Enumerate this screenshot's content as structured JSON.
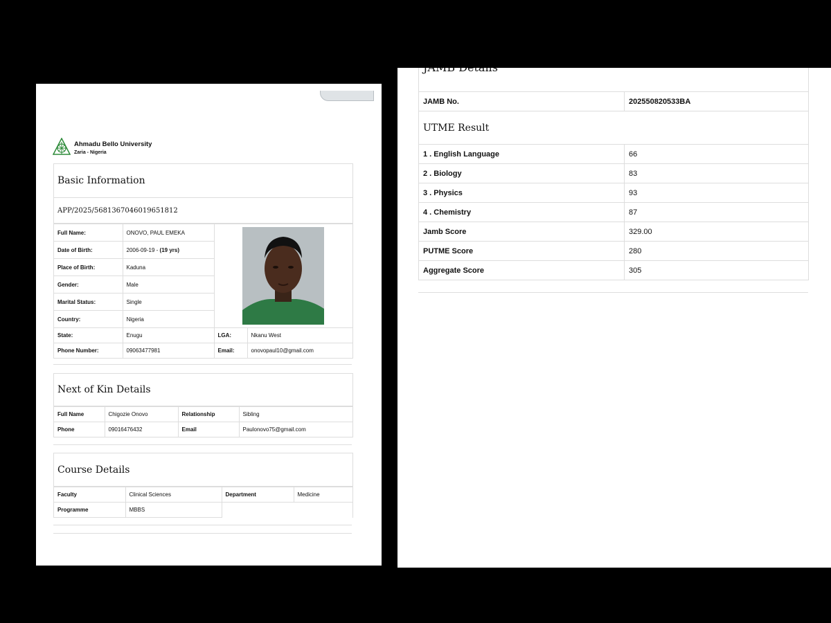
{
  "university": {
    "name": "Ahmadu Bello University",
    "location": "Zaria - Nigeria"
  },
  "basic": {
    "title": "Basic Information",
    "application_no": "APP/2025/5681367046019651812",
    "full_name_label": "Full Name:",
    "full_name": "ONOVO, PAUL EMEKA",
    "dob_label": "Date of Birth:",
    "dob": "2006-09-19 - ",
    "age": "(19 yrs)",
    "pob_label": "Place of Birth:",
    "pob": "Kaduna",
    "gender_label": "Gender:",
    "gender": "Male",
    "marital_label": "Marital Status:",
    "marital": "Single",
    "country_label": "Country:",
    "country": "Nigeria",
    "state_label": "State:",
    "state": "Enugu",
    "lga_label": "LGA:",
    "lga": "Nkanu West",
    "phone_label": "Phone Number:",
    "phone": "09063477981",
    "email_label": "Email:",
    "email": "onovopaul10@gmail.com"
  },
  "kin": {
    "title": "Next of Kin Details",
    "name_label": "Full Name",
    "name": "Chigozie Onovo",
    "relationship_label": "Relationship",
    "relationship": "Sibling",
    "phone_label": "Phone",
    "phone": "09016476432",
    "email_label": "Email",
    "email": "Paulonovo75@gmail.com"
  },
  "course": {
    "title": "Course Details",
    "faculty_label": "Faculty",
    "faculty": "Clinical Sciences",
    "department_label": "Department",
    "department": "Medicine",
    "programme_label": "Programme",
    "programme": "MBBS"
  },
  "jamb": {
    "title": "JAMB Details",
    "jamb_no_label": "JAMB No.",
    "jamb_no": "202550820533BA",
    "utme_title": "UTME Result",
    "subjects": [
      {
        "label": "1 . English Language",
        "score": "66"
      },
      {
        "label": "2 . Biology",
        "score": "83"
      },
      {
        "label": "3 . Physics",
        "score": "93"
      },
      {
        "label": "4 . Chemistry",
        "score": "87"
      }
    ],
    "jamb_score_label": "Jamb Score",
    "jamb_score": "329.00",
    "putme_label": "PUTME Score",
    "putme": "280",
    "aggregate_label": "Aggregate Score",
    "aggregate": "305"
  }
}
